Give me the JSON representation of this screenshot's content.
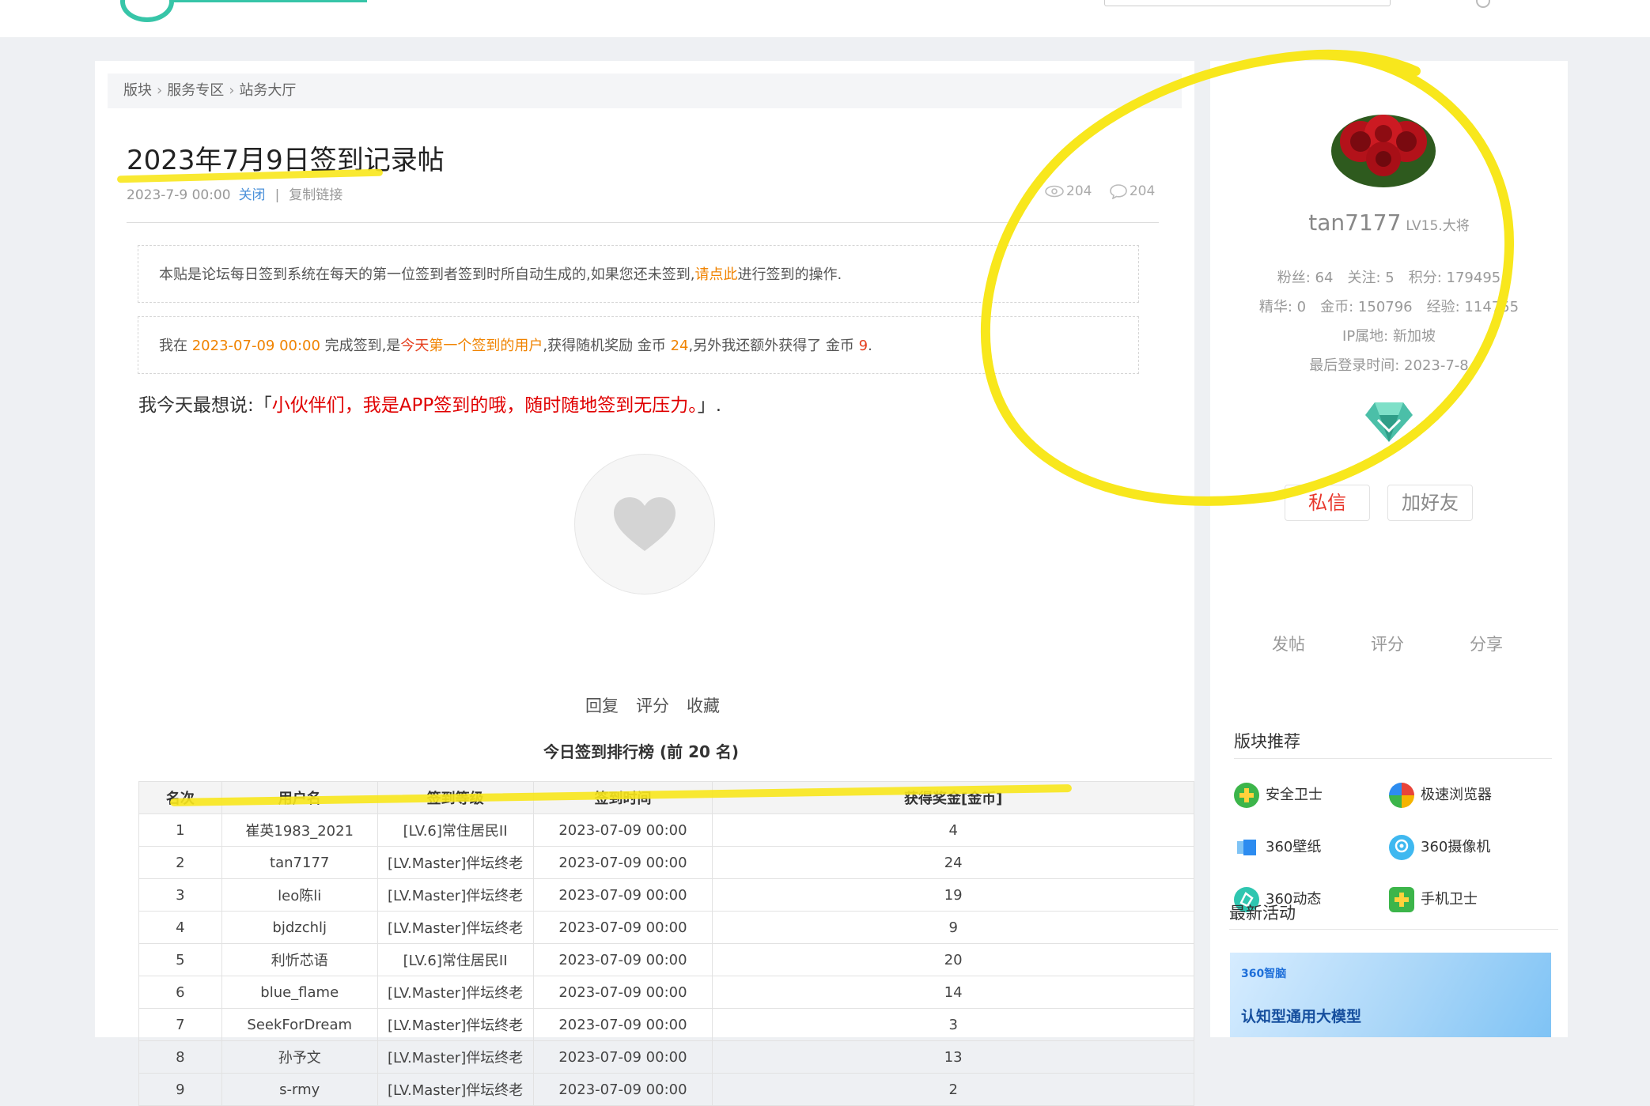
{
  "breadcrumb": [
    "版块",
    "服务专区",
    "站务大厅"
  ],
  "post": {
    "title": "2023年7月9日签到记录帖",
    "date": "2023-7-9 00:00",
    "close_label": "关闭",
    "separator": "|",
    "copy_link_label": "复制链接",
    "views": "204",
    "replies": "204"
  },
  "notice1": {
    "pre": "本贴是论坛每日签到系统在每天的第一位签到者签到时所自动生成的,如果您还未签到,",
    "link": "请点此",
    "post": "进行签到的操作."
  },
  "notice2": {
    "p1": "我在 ",
    "time": "2023-07-09 00:00",
    "p2": " 完成签到,是",
    "today": "今天",
    "first": "第一个签到的用户",
    "p3": ",获得随机奖励 金币 ",
    "coins": "24",
    "p4": ",另外我还额外获得了 金币 ",
    "extra": "9",
    "p5": "."
  },
  "mood": {
    "prefix": "我今天最想说:「",
    "text": "小伙伴们，我是APP签到的哦，随时随地签到无压力。",
    "suffix": "」."
  },
  "actions": [
    "回复",
    "评分",
    "收藏"
  ],
  "ranking": {
    "title": "今日签到排行榜 (前 20 名)",
    "headers": [
      "名次",
      "用户名",
      "签到等级",
      "签到时间",
      "获得奖金[金币]"
    ],
    "rows": [
      [
        "1",
        "崔英1983_2021",
        "[LV.6]常住居民II",
        "2023-07-09 00:00",
        "4"
      ],
      [
        "2",
        "tan7177",
        "[LV.Master]伴坛终老",
        "2023-07-09 00:00",
        "24"
      ],
      [
        "3",
        "leo陈li",
        "[LV.Master]伴坛终老",
        "2023-07-09 00:00",
        "19"
      ],
      [
        "4",
        "bjdzchlj",
        "[LV.Master]伴坛终老",
        "2023-07-09 00:00",
        "9"
      ],
      [
        "5",
        "利忻芯语",
        "[LV.6]常住居民II",
        "2023-07-09 00:00",
        "20"
      ],
      [
        "6",
        "blue_flame",
        "[LV.Master]伴坛终老",
        "2023-07-09 00:00",
        "14"
      ],
      [
        "7",
        "SeekForDream",
        "[LV.Master]伴坛终老",
        "2023-07-09 00:00",
        "3"
      ],
      [
        "8",
        "孙予文",
        "[LV.Master]伴坛终老",
        "2023-07-09 00:00",
        "13"
      ],
      [
        "9",
        "s-rmy",
        "[LV.Master]伴坛终老",
        "2023-07-09 00:00",
        "2"
      ]
    ]
  },
  "profile": {
    "username": "tan7177",
    "level": "LV15.大将",
    "fans": "粉丝: 64",
    "follow": "关注: 5",
    "points": "积分: 179495",
    "essence": "精华: 0",
    "coins": "金币: 150796",
    "exp": "经验: 114755",
    "ip": "IP属地: 新加坡",
    "last_login": "最后登录时间: 2023-7-8",
    "message_btn": "私信",
    "add_friend_btn": "加好友",
    "tabs": [
      "发帖",
      "评分",
      "分享"
    ]
  },
  "sidebar": {
    "recommend_title": "版块推荐",
    "apps": [
      {
        "name": "安全卫士",
        "icon": "shield-plus-icon",
        "color": "#3cb54a"
      },
      {
        "name": "极速浏览器",
        "icon": "browser-icon",
        "color": "#e8443a"
      },
      {
        "name": "360壁纸",
        "icon": "wallpaper-icon",
        "color": "#2d8cf0"
      },
      {
        "name": "360摄像机",
        "icon": "camera-icon",
        "color": "#3fb8f0"
      },
      {
        "name": "360动态",
        "icon": "dynamic-icon",
        "color": "#2fc6b0"
      },
      {
        "name": "手机卫士",
        "icon": "phone-guard-icon",
        "color": "#3cb54a"
      }
    ],
    "activity_title": "最新活动",
    "banner_logo": "360智脑",
    "banner_text": "认知型通用大模型"
  },
  "colors": {
    "accent_orange": "#f08300",
    "accent_red": "#e43e1e",
    "highlight_yellow": "#f8e71c"
  }
}
